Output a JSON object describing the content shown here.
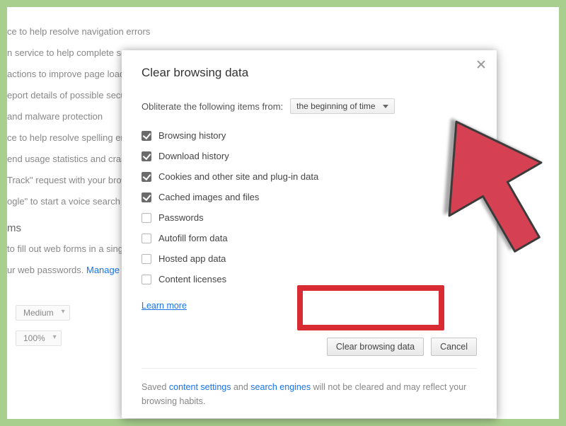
{
  "background": {
    "lines": [
      "ce to help resolve navigation errors",
      "n service to help complete sear",
      "actions to improve page load",
      "eport details of possible secur",
      "and malware protection",
      "ce to help resolve spelling err",
      "end usage statistics and crash",
      "Track\" request with your brow",
      "ogle\" to start a voice search"
    ],
    "forms_h": "ms",
    "forms_line": "to fill out web forms in a sing",
    "pw_line_pre": "ur web passwords.  ",
    "pw_link": "Manage p",
    "medium": "Medium",
    "zoom": "100%"
  },
  "dialog": {
    "title": "Clear browsing data",
    "obliterate_label": "Obliterate the following items from:",
    "time_range": "the beginning of time",
    "checks": [
      {
        "label": "Browsing history",
        "checked": true
      },
      {
        "label": "Download history",
        "checked": true
      },
      {
        "label": "Cookies and other site and plug-in data",
        "checked": true
      },
      {
        "label": "Cached images and files",
        "checked": true
      },
      {
        "label": "Passwords",
        "checked": false
      },
      {
        "label": "Autofill form data",
        "checked": false
      },
      {
        "label": "Hosted app data",
        "checked": false
      },
      {
        "label": "Content licenses",
        "checked": false
      }
    ],
    "learn_more": "Learn more",
    "clear_btn": "Clear browsing data",
    "cancel_btn": "Cancel",
    "footer": {
      "pre": "Saved ",
      "link1": "content settings",
      "mid": " and ",
      "link2": "search engines",
      "post": " will not be cleared and may reflect your browsing habits."
    }
  }
}
